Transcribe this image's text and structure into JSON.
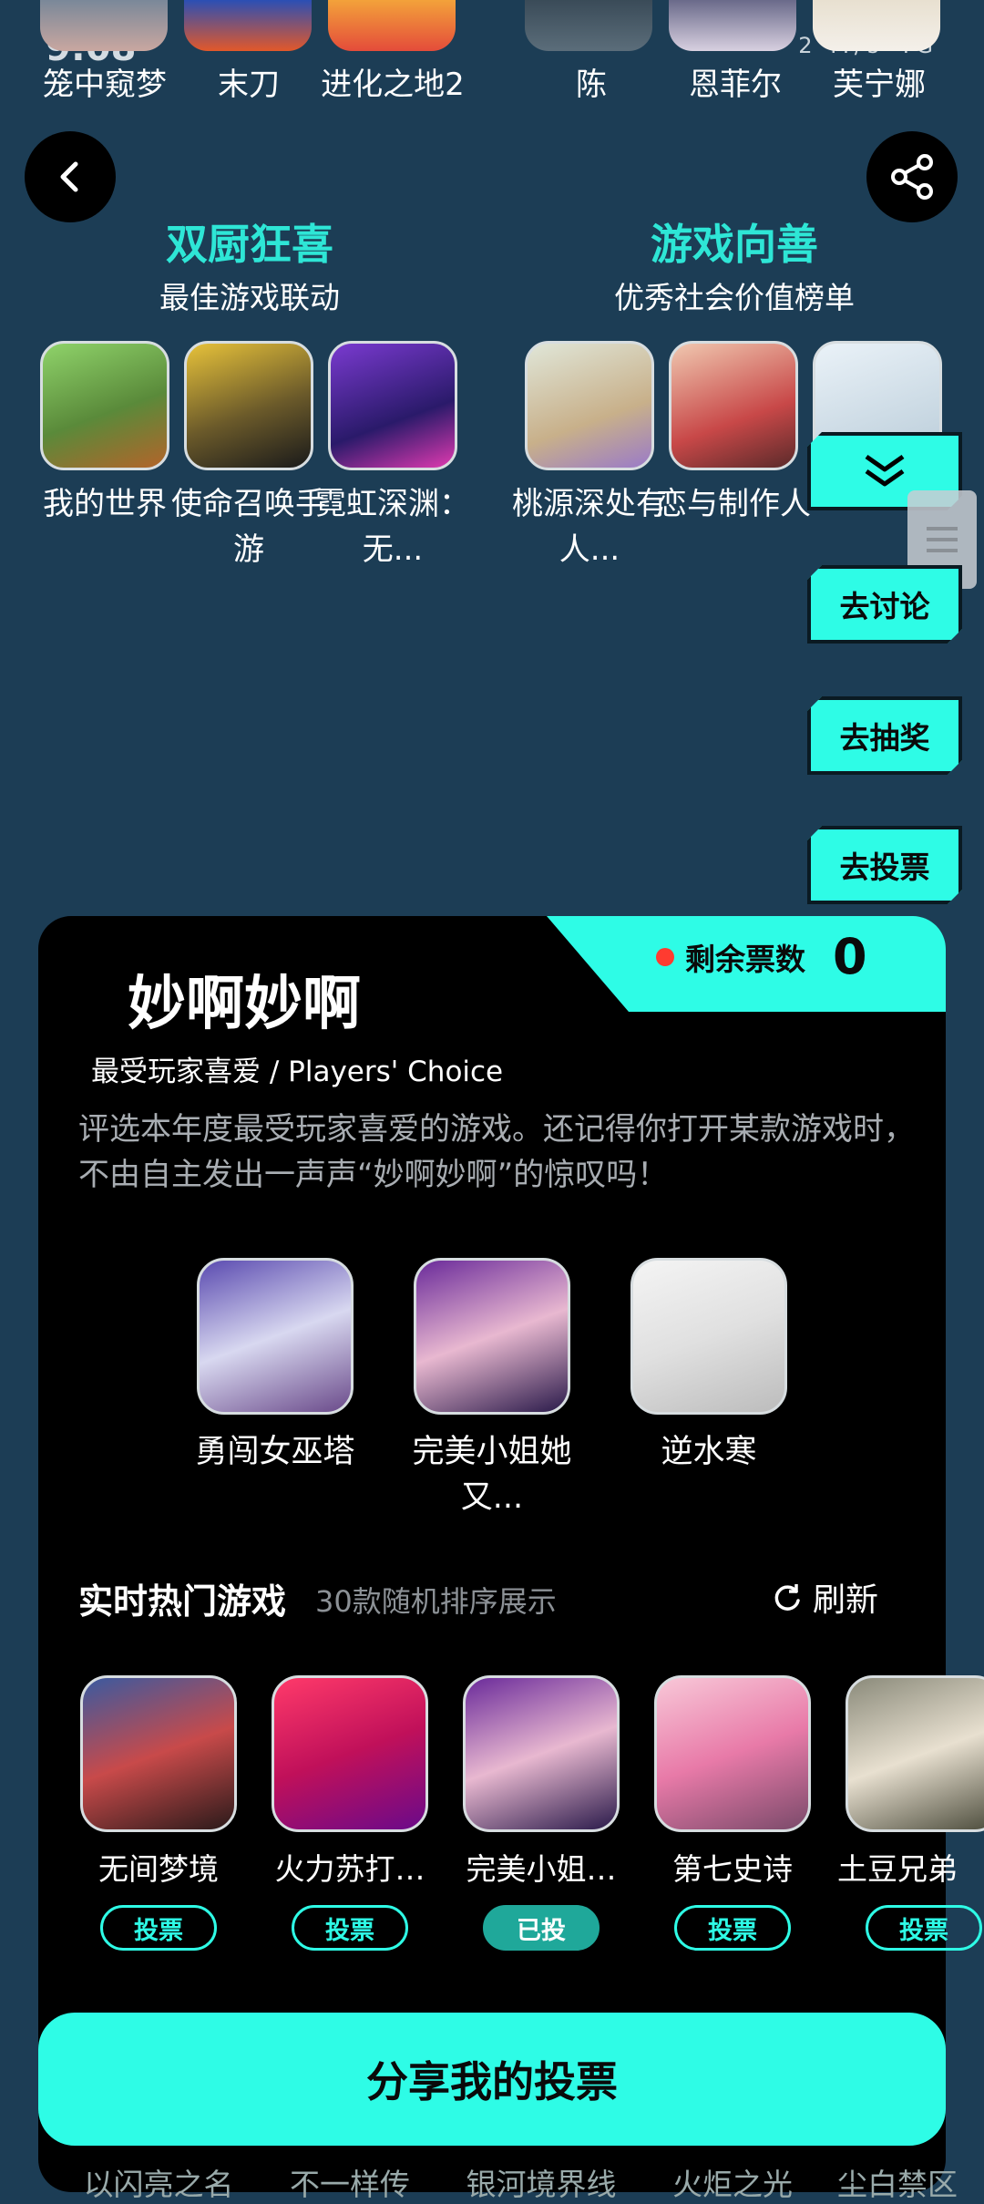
{
  "status": {
    "time": "9:08",
    "right": "2 M/s 4G"
  },
  "top_games": [
    "笼中窥梦",
    "末刀",
    "进化之地2",
    "陈",
    "恩菲尔",
    "芙宁娜"
  ],
  "sections": [
    {
      "title": "双厨狂喜",
      "subtitle": "最佳游戏联动",
      "games": [
        "我的世界",
        "使命召唤手游",
        "霓虹深渊：无..."
      ]
    },
    {
      "title": "游戏向善",
      "subtitle": "优秀社会价值榜单",
      "games": [
        "桃源深处有人...",
        "恋与制作人",
        ""
      ]
    }
  ],
  "side_actions": {
    "discuss": "去讨论",
    "lottery": "去抽奖",
    "vote": "去投票"
  },
  "card": {
    "remaining_label": "剩余票数",
    "remaining_count": "0",
    "title": "妙啊妙啊",
    "subtitle": "最受玩家喜爱 / Players' Choice",
    "description": "评选本年度最受玩家喜爱的游戏。还记得你打开某款游戏时，不由自主发出一声声“妙啊妙啊”的惊叹吗！",
    "nominees": [
      "勇闯女巫塔",
      "完美小姐她又...",
      "逆水寒"
    ]
  },
  "hot": {
    "title": "实时热门游戏",
    "hint": "30款随机排序展示",
    "refresh": "刷新",
    "games": [
      {
        "name": "无间梦境",
        "action": "投票",
        "voted": false
      },
      {
        "name": "火力苏打…",
        "action": "投票",
        "voted": false
      },
      {
        "name": "完美小姐…",
        "action": "已投",
        "voted": true
      },
      {
        "name": "第七史诗",
        "action": "投票",
        "voted": false
      },
      {
        "name": "土豆兄弟",
        "action": "投票",
        "voted": false
      }
    ],
    "next_row": [
      "以闪亮之名",
      "不一样传",
      "银河境界线",
      "火炬之光",
      "尘白禁区"
    ]
  },
  "share_button": "分享我的投票",
  "colors": {
    "bg": "#1c3d55",
    "accent": "#2efce6",
    "card": "#000000"
  }
}
